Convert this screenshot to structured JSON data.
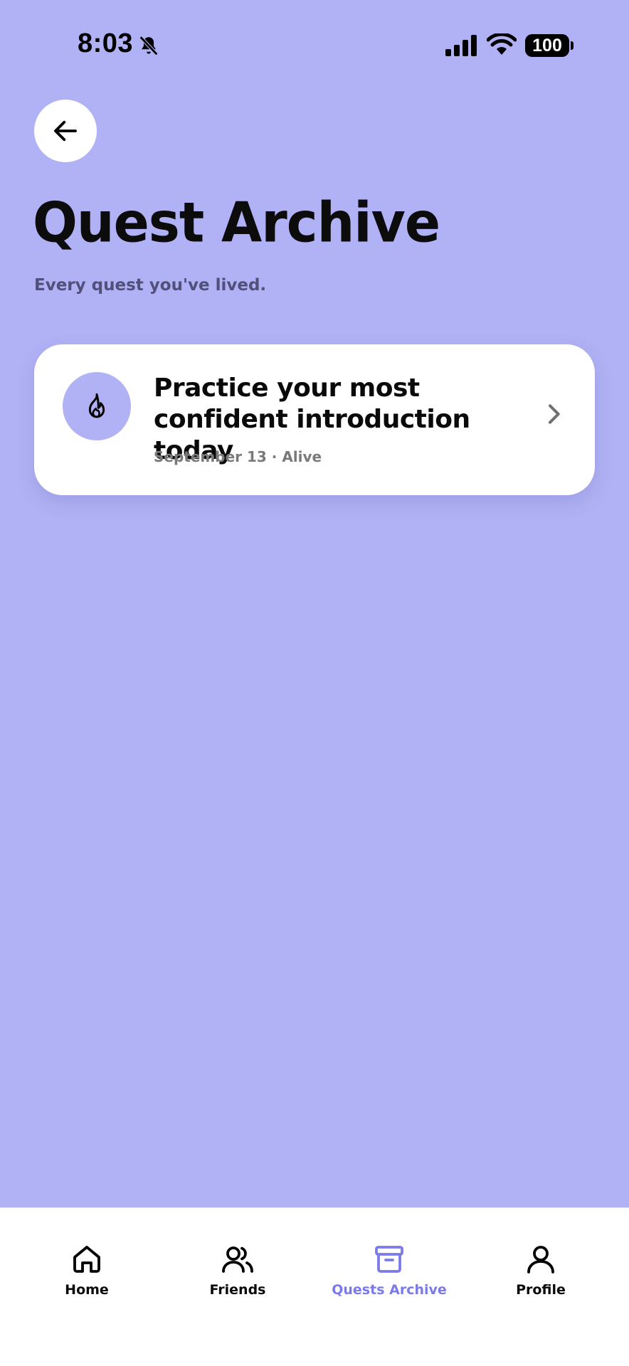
{
  "status_bar": {
    "time": "8:03",
    "battery": "100",
    "icons": [
      "bell-slash-icon",
      "signal-icon",
      "wifi-icon",
      "battery-icon"
    ]
  },
  "header": {
    "back_icon": "arrow-left-icon",
    "title": "Quest Archive",
    "subtitle": "Every quest you've lived."
  },
  "quests": [
    {
      "icon": "flame-icon",
      "title": "Practice your most confident introduction today",
      "date": "September 13",
      "separator": "·",
      "status": "Alive",
      "meta": "September 13 · Alive"
    }
  ],
  "nav": {
    "items": [
      {
        "label": "Home",
        "icon": "home-icon",
        "active": false
      },
      {
        "label": "Friends",
        "icon": "friends-icon",
        "active": false
      },
      {
        "label": "Quests Archive",
        "icon": "archive-icon",
        "active": true
      },
      {
        "label": "Profile",
        "icon": "profile-icon",
        "active": false
      }
    ]
  },
  "colors": {
    "background": "#b1b1f5",
    "card": "#ffffff",
    "accent": "#7a7aea",
    "text": "#0a0a0a",
    "muted": "#7a7a7a"
  }
}
